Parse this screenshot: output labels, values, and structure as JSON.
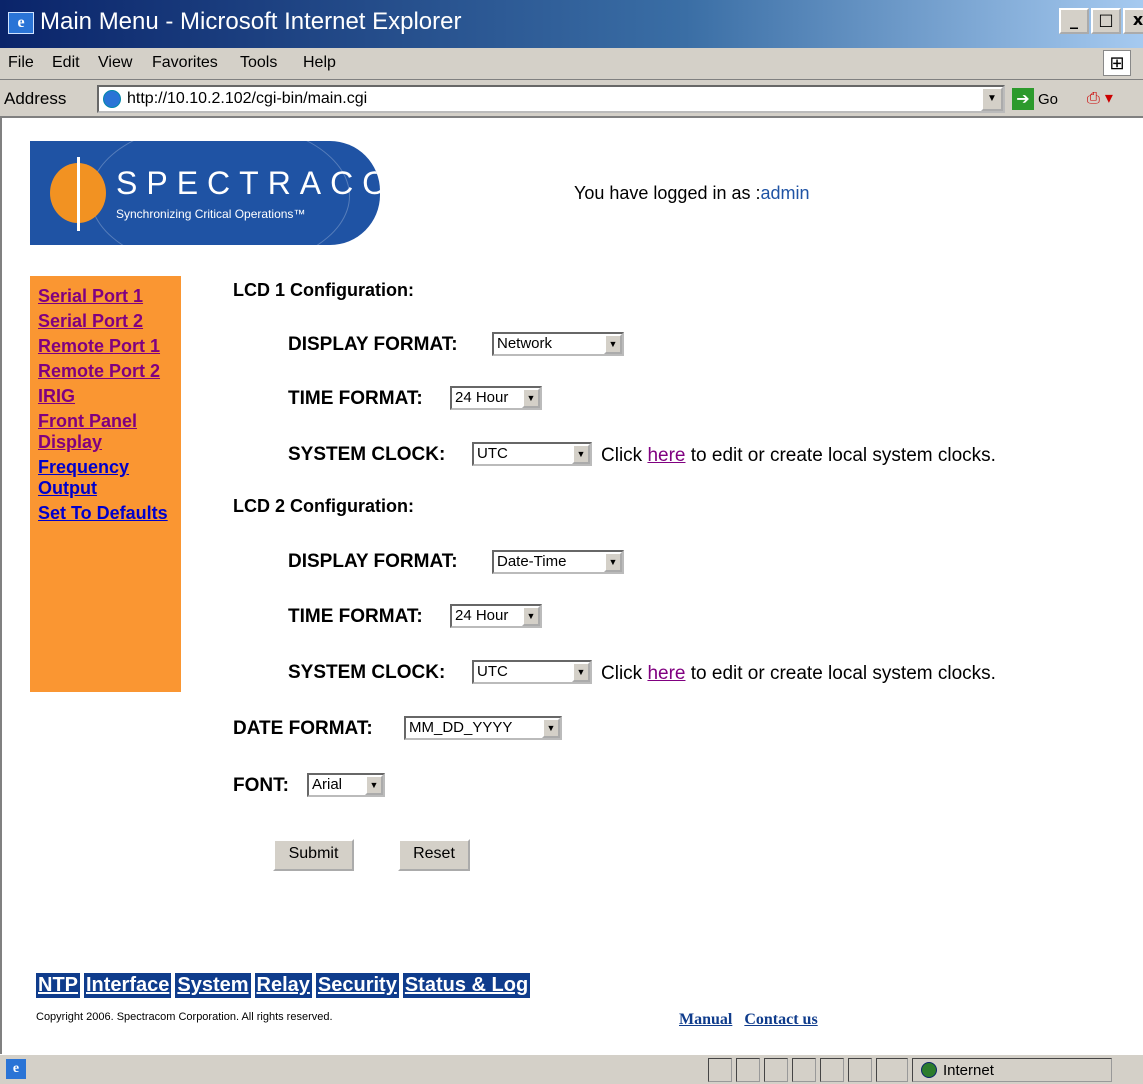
{
  "window": {
    "title": "Main Menu - Microsoft Internet Explorer",
    "icon": "ie-page-icon",
    "controls": [
      "_",
      "□",
      "x"
    ]
  },
  "menubar": {
    "items": [
      "File",
      "Edit",
      "View",
      "Favorites",
      "Tools",
      "Help"
    ]
  },
  "addressbar": {
    "label": "Address",
    "url": "http://10.10.2.102/cgi-bin/main.cgi",
    "go_label": "Go"
  },
  "header": {
    "brand": "SPECTRACOM",
    "tagline": "Synchronizing Critical Operations™",
    "login_prefix": "You have logged in as :",
    "login_user": "admin"
  },
  "sidebar": {
    "items": [
      {
        "label": "Serial Port 1"
      },
      {
        "label": "Serial Port 2"
      },
      {
        "label": "Remote Port 1"
      },
      {
        "label": "Remote Port 2"
      },
      {
        "label": "IRIG"
      },
      {
        "label": "Front Panel Display"
      },
      {
        "label": "Frequency Output"
      },
      {
        "label": "Set To Defaults"
      }
    ]
  },
  "form": {
    "lcd1": {
      "title": "LCD 1 Configuration:",
      "display_format_label": "DISPLAY FORMAT:",
      "display_format_value": "Network",
      "time_format_label": "TIME FORMAT:",
      "time_format_value": "24 Hour",
      "system_clock_label": "SYSTEM CLOCK:",
      "system_clock_value": "UTC",
      "help_prefix": "Click",
      "help_link": "here",
      "help_suffix": "to edit or create local system clocks."
    },
    "lcd2": {
      "title": "LCD 2 Configuration:",
      "display_format_label": "DISPLAY FORMAT:",
      "display_format_value": "Date-Time",
      "time_format_label": "TIME FORMAT:",
      "time_format_value": "24 Hour",
      "system_clock_label": "SYSTEM CLOCK:",
      "system_clock_value": "UTC",
      "help_prefix": "Click",
      "help_link": "here",
      "help_suffix": "to edit or create local system clocks."
    },
    "date_format_label": "DATE FORMAT:",
    "date_format_value": "MM_DD_YYYY",
    "font_label": "FONT:",
    "font_value": "Arial",
    "submit_label": "Submit",
    "reset_label": "Reset"
  },
  "bottomnav": {
    "items": [
      "NTP",
      "Interface",
      "System",
      "Relay",
      "Security",
      "Status & Log"
    ]
  },
  "footer": {
    "copyright": "Copyright 2006. Spectracom Corporation. All rights reserved.",
    "manual": "Manual",
    "contact": "Contact us"
  },
  "statusbar": {
    "zone": "Internet"
  },
  "colors": {
    "sidebar_bg": "#fa9632",
    "nav_bg": "#0f3c8c",
    "logo_bg": "#1f53a4",
    "visited_link": "#800080"
  }
}
